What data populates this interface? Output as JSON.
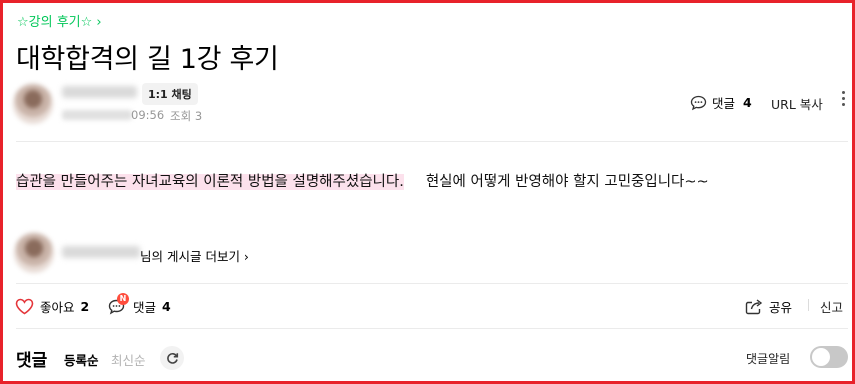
{
  "cafe": {
    "link_label": "☆강의 후기☆",
    "chevron": "›"
  },
  "post": {
    "title": "대학합격의 길 1강 후기",
    "chat_badge": "1:1 채팅",
    "time": "09:56",
    "views": "조회 3",
    "body_highlighted": "습관을 만들어주는 자녀교육의 이론적 방법을 설명해주셨습니다.",
    "body_rest": "현실에 어떻게 반영해야 할지 고민중입니다~~"
  },
  "header_actions": {
    "comment_label": "댓글",
    "comment_count": "4",
    "url_copy": "URL 복사"
  },
  "author_more": {
    "suffix": "님의 게시글 더보기 ›"
  },
  "actions": {
    "like_label": "좋아요",
    "like_count": "2",
    "comment_label": "댓글",
    "comment_count": "4",
    "new_badge": "N",
    "share_label": "공유",
    "report_label": "신고"
  },
  "comments": {
    "title": "댓글",
    "sort_registered": "등록순",
    "sort_newest": "최신순",
    "alarm_label": "댓글알림"
  },
  "colors": {
    "accent_green": "#03c75a",
    "frame_red": "#e8222a",
    "highlight_pink": "#fce1ec",
    "badge_red": "#ff4d3d"
  },
  "icons": [
    "chat-bubble-icon",
    "more-vertical-icon",
    "heart-icon",
    "comment-icon",
    "share-icon",
    "refresh-icon"
  ]
}
